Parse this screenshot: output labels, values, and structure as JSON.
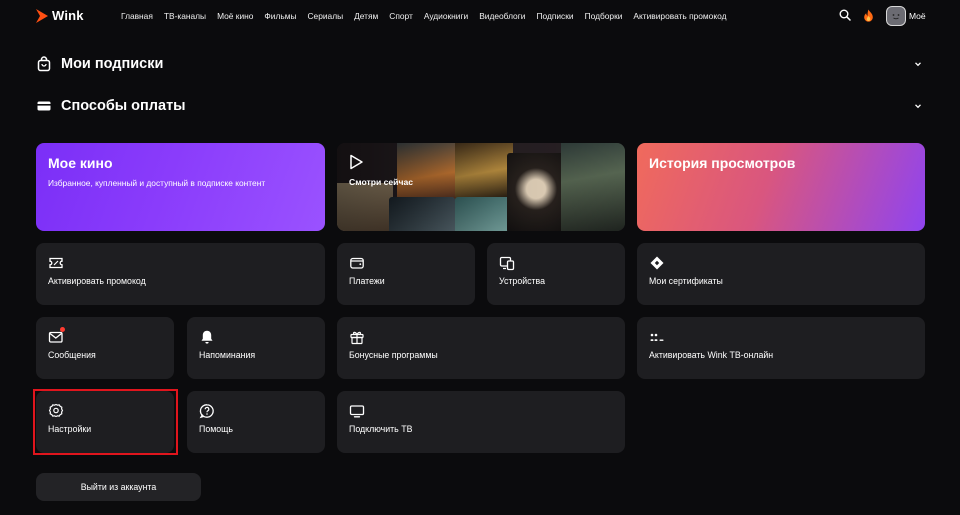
{
  "header": {
    "logo_text": "Wink",
    "nav": [
      "Главная",
      "ТВ-каналы",
      "Моё кино",
      "Фильмы",
      "Сериалы",
      "Детям",
      "Спорт",
      "Аудиокниги",
      "Видеоблоги",
      "Подписки",
      "Подборки",
      "Активировать промокод"
    ],
    "profile_label": "Моё",
    "icons": [
      "search-icon",
      "fire-icon",
      "avatar"
    ]
  },
  "sections": {
    "subscriptions": "Мои подписки",
    "payment_methods": "Способы оплаты"
  },
  "tiles": {
    "my_kino": {
      "title": "Мое кино",
      "subtitle": "Избранное, купленный и доступный в подписке контент"
    },
    "watch_now": {
      "label": "Смотри сейчас"
    },
    "history": {
      "title": "История просмотров"
    },
    "promocode": "Активировать промокод",
    "payments": "Платежи",
    "devices": "Устройства",
    "certificates": "Мои сертификаты",
    "messages": "Сообщения",
    "reminders": "Напоминания",
    "bonus": "Бонусные программы",
    "activate_tv": "Активировать Wink ТВ-онлайн",
    "settings": "Настройки",
    "help": "Помощь",
    "connect_tv": "Подключить ТВ"
  },
  "logout_label": "Выйти из аккаунта",
  "colors": {
    "background": "#0b0b0d",
    "tile": "#1e1e21",
    "brand": "#ff4f12",
    "highlight": "#e0151d",
    "mykino_gradient": [
      "#7b2ff7",
      "#9a52ff"
    ],
    "history_gradient": [
      "#f06a5c",
      "#8f44f0"
    ]
  }
}
